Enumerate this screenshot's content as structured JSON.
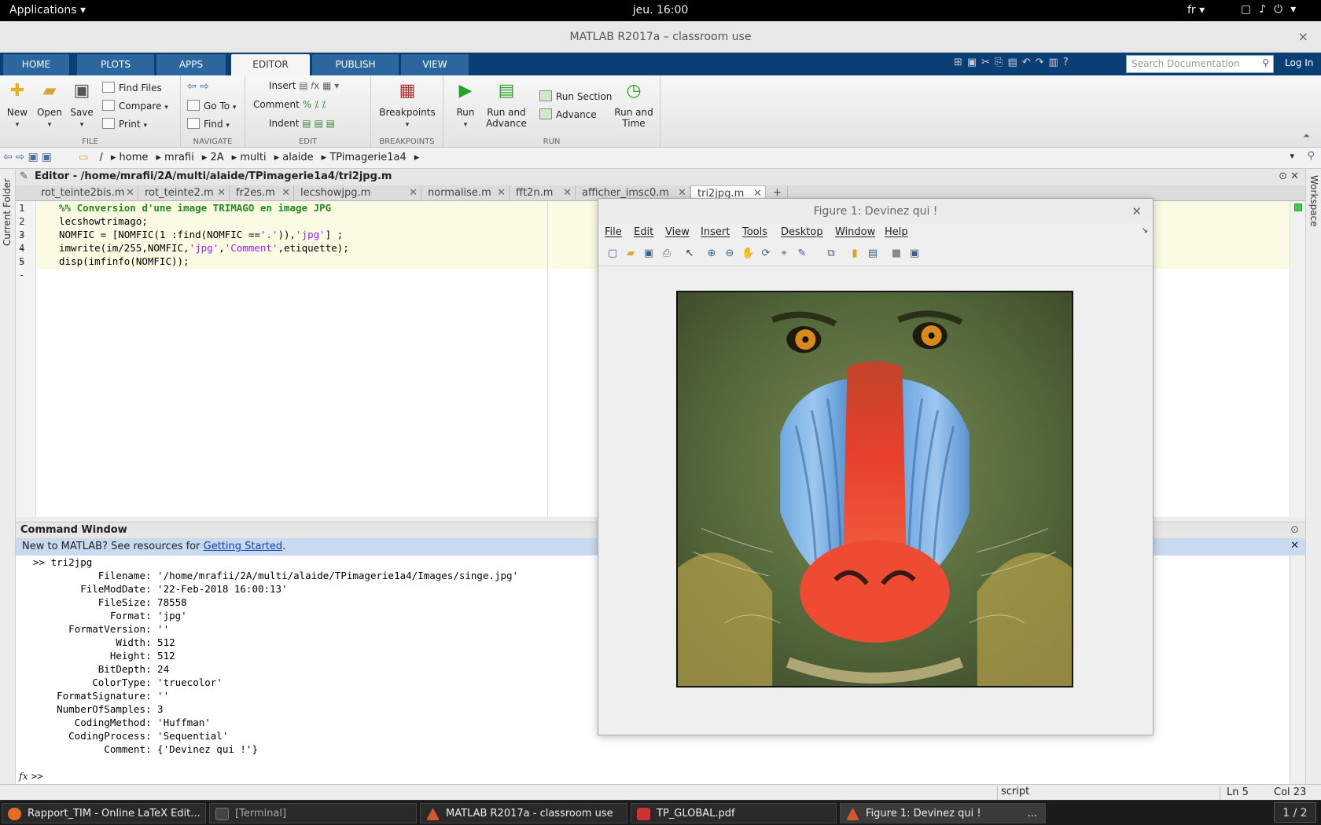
{
  "topbar": {
    "applications": "Applications",
    "clock": "jeu. 16:00",
    "lang": "fr"
  },
  "window": {
    "title": "MATLAB R2017a – classroom use",
    "close": "×"
  },
  "ribbon": {
    "tabs": [
      "HOME",
      "PLOTS",
      "APPS",
      "EDITOR",
      "PUBLISH",
      "VIEW"
    ],
    "active_tab": "EDITOR",
    "search_placeholder": "Search Documentation",
    "login": "Log In",
    "file": {
      "label": "FILE",
      "new": "New",
      "open": "Open",
      "save": "Save",
      "find_files": "Find Files",
      "compare": "Compare",
      "print": "Print"
    },
    "navigate": {
      "label": "NAVIGATE",
      "goto": "Go To",
      "find": "Find"
    },
    "edit": {
      "label": "EDIT",
      "insert": "Insert",
      "comment": "Comment",
      "indent": "Indent"
    },
    "breakpoints": {
      "label": "BREAKPOINTS",
      "breakpoints": "Breakpoints"
    },
    "run": {
      "label": "RUN",
      "run": "Run",
      "run_and_advance_1": "Run and",
      "run_and_advance_2": "Advance",
      "run_section": "Run Section",
      "advance": "Advance",
      "run_and_time_1": "Run and",
      "run_and_time_2": "Time"
    }
  },
  "address": {
    "segments": [
      "/",
      "home",
      "mrafii",
      "2A",
      "multi",
      "alaide",
      "TPimagerie1a4"
    ]
  },
  "rails": {
    "left": "Current Folder",
    "right": "Workspace"
  },
  "editor": {
    "title": "Editor - /home/mrafii/2A/multi/alaide/TPimagerie1a4/tri2jpg.m",
    "tabs": [
      "rot_teinte2bis.m",
      "rot_teinte2.m",
      "fr2es.m",
      "lecshowjpg.m",
      "normalise.m",
      "fft2n.m",
      "afficher_imsc0.m",
      "tri2jpg.m"
    ],
    "add_tab": "+",
    "gutter": [
      "1",
      "2 -",
      "3 -",
      "4 -",
      "5 -"
    ],
    "lines": [
      {
        "text": "%% Conversion d'une image TRIMAGO en image JPG"
      },
      {
        "text": "lecshowtrimago;"
      },
      {
        "a": "NOMFIC = [NOMFIC(1 :find(NOMFIC ==",
        "s1": "'.'",
        "b": ")),",
        "s2": "'jpg'",
        "c": "] ;"
      },
      {
        "a": "imwrite(im/255,NOMFIC,",
        "s1": "'jpg'",
        "b": ",",
        "s2": "'Comment'",
        "c": ",etiquette);"
      },
      {
        "text": "disp(imfinfo(NOMFIC));"
      }
    ]
  },
  "command": {
    "title": "Command Window",
    "banner_text": "New to MATLAB? See resources for ",
    "banner_link": "Getting Started",
    "banner_end": ".",
    "output": [
      ">> tri2jpg",
      "           Filename: '/home/mrafii/2A/multi/alaide/TPimagerie1a4/Images/singe.jpg'",
      "        FileModDate: '22-Feb-2018 16:00:13'",
      "           FileSize: 78558",
      "             Format: 'jpg'",
      "      FormatVersion: ''",
      "              Width: 512",
      "             Height: 512",
      "           BitDepth: 24",
      "          ColorType: 'truecolor'",
      "    FormatSignature: ''",
      "    NumberOfSamples: 3",
      "       CodingMethod: 'Huffman'",
      "      CodingProcess: 'Sequential'",
      "            Comment: {'Devinez qui !'}"
    ],
    "prompt": ">>",
    "fx": "fx"
  },
  "status": {
    "mode": "script",
    "ln_label": "Ln",
    "ln": "5",
    "col_label": "Col",
    "col": "23"
  },
  "figure": {
    "title": "Figure 1: Devinez qui !",
    "menu": [
      "File",
      "Edit",
      "View",
      "Insert",
      "Tools",
      "Desktop",
      "Window",
      "Help"
    ]
  },
  "taskbar": {
    "items": [
      "Rapport_TIM - Online LaTeX Edit...",
      "[Terminal]",
      "MATLAB R2017a - classroom use",
      "TP_GLOBAL.pdf",
      "Figure 1: Devinez qui !"
    ],
    "more": "...",
    "pager": "1 / 2"
  },
  "colors": {
    "ribbon_dark": "#0a3f75",
    "tab_blue": "#2b679e",
    "comment_green": "#228b22",
    "string_purple": "#a020f0",
    "link_blue": "#0b3fb0"
  }
}
